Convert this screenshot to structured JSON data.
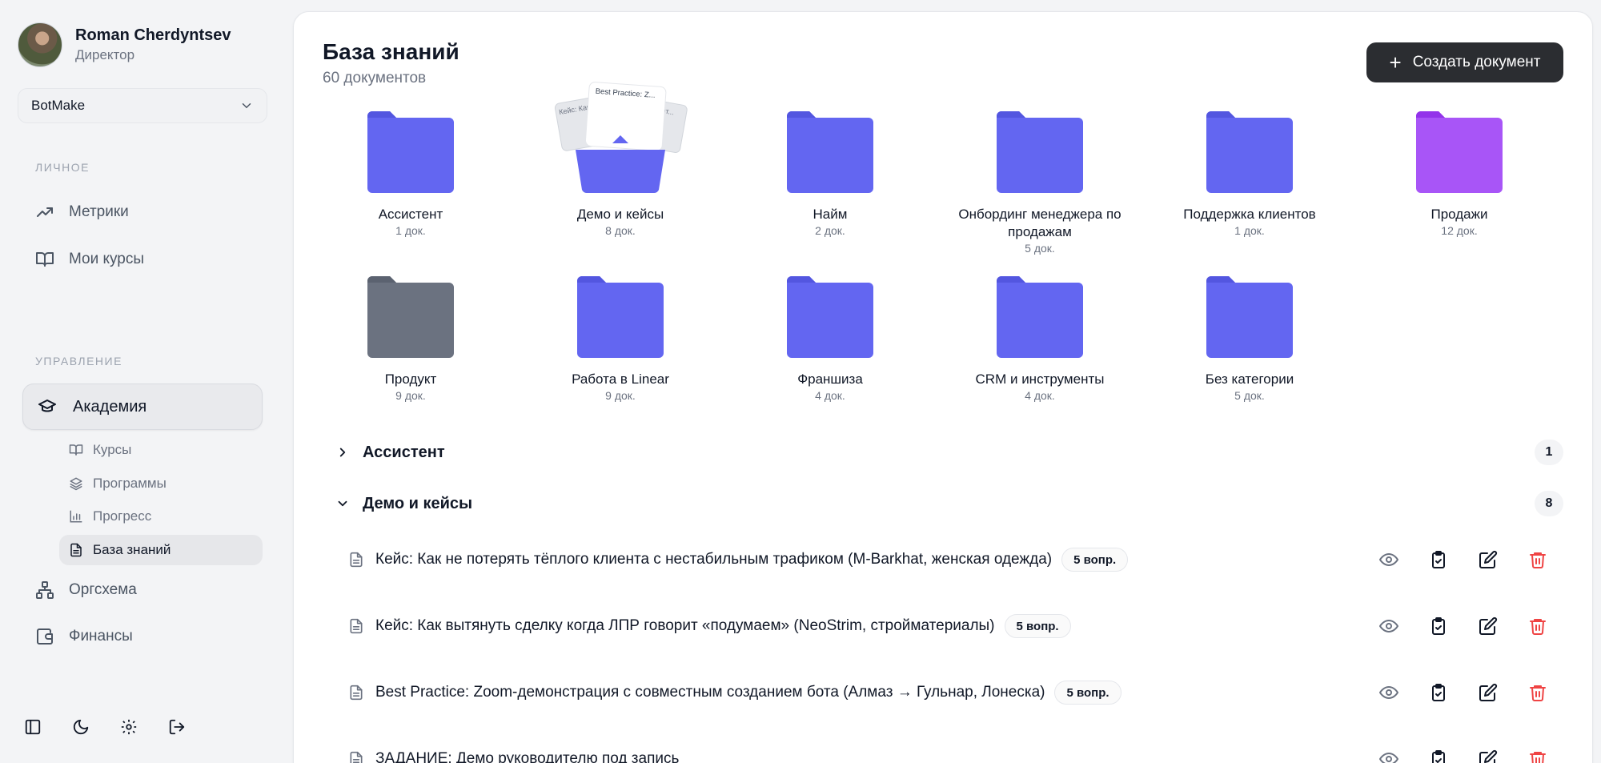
{
  "user": {
    "name": "Roman Cherdyntsev",
    "role": "Директор"
  },
  "org_select": {
    "value": "BotMake"
  },
  "sidebar": {
    "section_personal": "ЛИЧНОЕ",
    "metrics": "Метрики",
    "my_courses": "Мои курсы",
    "section_manage": "УПРАВЛЕНИЕ",
    "academy": "Академия",
    "sub": {
      "courses": "Курсы",
      "programs": "Программы",
      "progress": "Прогресс",
      "knowledge": "База знаний"
    },
    "orgchart": "Оргсхема",
    "finance": "Финансы"
  },
  "header": {
    "title": "База знаний",
    "subtitle": "60 документов",
    "create_button": "Создать документ"
  },
  "folders": [
    {
      "name": "Ассистент",
      "count": "1 док.",
      "color": "#6366f1",
      "open": false
    },
    {
      "name": "Демо и кейсы",
      "count": "8 док.",
      "color": "#6366f1",
      "open": true,
      "peek": [
        "Best Practice: Z...",
        "Кейс: Как...",
        "Как выт..."
      ]
    },
    {
      "name": "Найм",
      "count": "2 док.",
      "color": "#6366f1",
      "open": false
    },
    {
      "name": "Онбординг менеджера по продажам",
      "count": "5 док.",
      "color": "#6366f1",
      "open": false
    },
    {
      "name": "Поддержка клиентов",
      "count": "1 док.",
      "color": "#6366f1",
      "open": false
    },
    {
      "name": "Продажи",
      "count": "12 док.",
      "color": "#a855f7",
      "open": false
    },
    {
      "name": "Продукт",
      "count": "9 док.",
      "color": "#6b7280",
      "open": false
    },
    {
      "name": "Работа в Linear",
      "count": "9 док.",
      "color": "#6366f1",
      "open": false
    },
    {
      "name": "Франшиза",
      "count": "4 док.",
      "color": "#6366f1",
      "open": false
    },
    {
      "name": "CRM и инструменты",
      "count": "4 док.",
      "color": "#6366f1",
      "open": false
    },
    {
      "name": "Без категории",
      "count": "5 док.",
      "color": "#6366f1",
      "open": false
    }
  ],
  "groups": [
    {
      "title": "Ассистент",
      "count": "1",
      "expanded": false
    },
    {
      "title": "Демо и кейсы",
      "count": "8",
      "expanded": true
    }
  ],
  "documents": [
    {
      "title": "Кейс: Как не потерять тёплого клиента с нестабильным трафиком (M-Barkhat, женская одежда)",
      "badge": "5 вопр."
    },
    {
      "title": "Кейс: Как вытянуть сделку когда ЛПР говорит «подумаем» (NeoStrim, стройматериалы)",
      "badge": "5 вопр."
    },
    {
      "title": "Best Practice: Zoom-демонстрация с совместным созданием бота (Алмаз → Гульнар, Лонеска)",
      "badge": "5 вопр."
    },
    {
      "title": "ЗАДАНИЕ: Демо руководителю под запись",
      "badge": ""
    }
  ],
  "colors": {
    "accent": "#6366f1",
    "danger": "#ef4444",
    "dark_button": "#2b2d31"
  }
}
